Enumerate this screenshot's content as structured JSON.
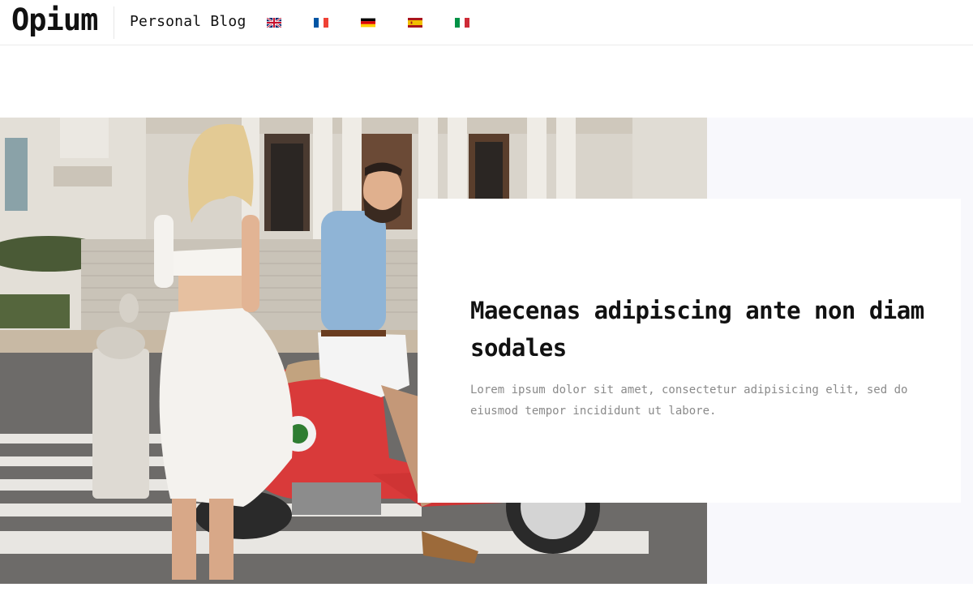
{
  "header": {
    "logo": "Opium",
    "tagline": "Personal Blog",
    "languages": [
      {
        "code": "en",
        "icon": "uk-flag-icon"
      },
      {
        "code": "fr",
        "icon": "france-flag-icon"
      },
      {
        "code": "de",
        "icon": "germany-flag-icon"
      },
      {
        "code": "es",
        "icon": "spain-flag-icon"
      },
      {
        "code": "it",
        "icon": "italy-flag-icon"
      }
    ]
  },
  "hero": {
    "image": "couple-with-red-scooter-photo",
    "title": "Maecenas adipiscing ante non diam sodales",
    "excerpt": "Lorem ipsum dolor sit amet, consectetur adipisicing elit, sed do eiusmod tempor incididunt ut labore."
  },
  "colors": {
    "panel_bg": "#f8f8fc",
    "text_muted": "#8a8a8a",
    "scooter_red": "#d93a3a"
  }
}
